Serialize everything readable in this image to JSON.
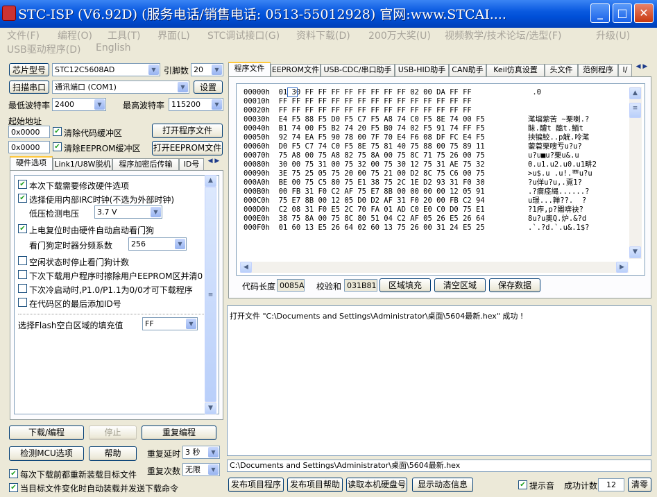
{
  "window": {
    "title": "STC-ISP (V6.92D) (服务电话/销售电话: 0513-55012928) 官网:www.STCAI...."
  },
  "menu": [
    "文件(F)",
    "编程(O)",
    "工具(T)",
    "界面(L)",
    "STC调试接口(G)",
    "资料下载(D)",
    "200万大奖(U)",
    "视频教学/技术论坛/选型(F)",
    "升级(U)",
    "USB驱动程序(D)",
    "English"
  ],
  "left": {
    "chip_btn": "芯片型号",
    "chip_value": "STC12C5608AD",
    "pin_label": "引脚数",
    "pin_value": "20",
    "scan_btn": "扫描串口",
    "port_value": "通讯端口 (COM1)",
    "settings_btn": "设置",
    "min_baud_label": "最低波特率",
    "min_baud": "2400",
    "max_baud_label": "最高波特率",
    "max_baud": "115200",
    "start_addr_label": "起始地址",
    "addr1": "0x0000",
    "clear_code": "清除代码缓冲区",
    "open_prog": "打开程序文件",
    "addr2": "0x0000",
    "clear_eeprom": "清除EEPROM缓冲区",
    "open_eeprom": "打开EEPROM文件",
    "tabs": [
      "硬件选项",
      "Link1/U8W脱机",
      "程序加密后传输",
      "ID号"
    ],
    "options": [
      {
        "label": "本次下载需要修改硬件选项",
        "checked": true
      },
      {
        "label": "选择使用内部IRC时钟(不选为外部时钟)",
        "checked": true
      },
      {
        "label": "低压检测电压",
        "value": "3.7 V"
      },
      {
        "label": "上电复位时由硬件自动启动看门狗",
        "checked": true
      },
      {
        "label": "看门狗定时器分频系数",
        "value": "256"
      },
      {
        "label": "空闲状态时停止看门狗计数",
        "checked": false
      },
      {
        "label": "下次下载用户程序时擦除用户EEPROM区并清0",
        "checked": false
      },
      {
        "label": "下次冷启动时,P1.0/P1.1为0/0才可下载程序",
        "checked": false
      },
      {
        "label": "在代码区的最后添加ID号",
        "checked": false
      }
    ],
    "fill_label": "选择Flash空白区域的填充值",
    "fill_value": "FF",
    "download_btn": "下载/编程",
    "stop_btn": "停止",
    "repeat_btn": "重复编程",
    "check_mcu_btn": "检测MCU选项",
    "help_btn": "帮助",
    "repeat_delay_label": "重复延时",
    "repeat_delay": "3 秒",
    "repeat_count_label": "重复次数",
    "repeat_count": "无限",
    "auto_reload": "每次下载前都重新装载目标文件",
    "auto_send": "当目标文件变化时自动装载并发送下载命令"
  },
  "right": {
    "tabs": [
      "程序文件",
      "EEPROM文件",
      "USB-CDC/串口助手",
      "USB-HID助手",
      "CAN助手",
      "Keil仿真设置",
      "头文件",
      "范例程序",
      "I/"
    ],
    "hex_rows": [
      {
        "addr": "00000h",
        "bytes": "01 30 FF FF FF FF FF FF FF FF 02 00 DA FF FF",
        "ascii": " .0"
      },
      {
        "addr": "00010h",
        "bytes": "FF FF FF FF FF FF FF FF FF FF FF FF FF FF FF",
        "ascii": ""
      },
      {
        "addr": "00020h",
        "bytes": "FF FF FF FF FF FF FF FF FF FF FF FF FF FF FF",
        "ascii": ""
      },
      {
        "addr": "00030h",
        "bytes": "E4 F5 88 F5 D0 F5 C7 F5 A8 74 C0 F5 8E 74 00 F5",
        "ascii": "滗堛萦苦 ~栗喇.?"
      },
      {
        "addr": "00040h",
        "bytes": "B1 74 00 F5 B2 74 20 F5 B0 74 02 F5 91 74 FF F5",
        "ascii": "眛.醴t 醢t.鮞t"
      },
      {
        "addr": "00050h",
        "bytes": "92 74 EA F5 90 78 00 7F 70 E4 F6 08 DF FC E4 F5",
        "ascii": "抰犏鮫..p觥.呤滗"
      },
      {
        "addr": "00060h",
        "bytes": "D0 F5 C7 74 C0 F5 8E 75 81 40 75 88 00 75 89 11",
        "ascii": "蓥菪栗嗖亐u?u?"
      },
      {
        "addr": "00070h",
        "bytes": "75 A8 00 75 A8 82 75 8A 00 75 8C 71 75 26 00 75",
        "ascii": "u?u■u?栗u&.u"
      },
      {
        "addr": "00080h",
        "bytes": "30 00 75 31 00 75 32 00 75 30 12 75 31 AE 75 32",
        "ascii": "0.u1.u2.u0.u1畊2"
      },
      {
        "addr": "00090h",
        "bytes": "3E 75 25 05 75 20 00 75 21 00 D2 8C 75 C6 00 75",
        "ascii": ">u$.u .u!.覀u?u"
      },
      {
        "addr": "000A0h",
        "bytes": "BE 00 75 C5 80 75 E1 38 75 2C 1E D2 93 31 F0 30",
        "ascii": "?u佯u?u,.覔1?"
      },
      {
        "addr": "000B0h",
        "bytes": "00 FB 31 F0 C2 AF 75 E7 8B 00 00 00 00 12 05 91",
        "ascii": ".?瘸痉縄......?"
      },
      {
        "addr": "000C0h",
        "bytes": "75 E7 8B 00 12 05 D0 D2 AF 31 F0 20 00 FB C2 94",
        "ascii": "u璟...亸??.  ?"
      },
      {
        "addr": "000D0h",
        "bytes": "C2 08 31 F0 E5 2C 70 FA 01 AD C0 E0 C0 D0 75 E1",
        "ascii": "?1痄,p?闂喯袂?"
      },
      {
        "addr": "000E0h",
        "bytes": "38 75 8A 00 75 8C 80 51 04 C2 AF 05 26 E5 26 64",
        "ascii": "8u?u奧Q.炉.&?d"
      },
      {
        "addr": "000F0h",
        "bytes": "01 60 13 E5 26 64 02 60 13 75 26 00 31 24 E5 25",
        "ascii": ".`.?d.`.u&.1$?"
      }
    ],
    "code_len_label": "代码长度",
    "code_len": "0085A",
    "checksum_label": "校验和",
    "checksum": "031B81",
    "fill_btn": "区域填充",
    "clear_btn": "清空区域",
    "save_btn": "保存数据",
    "log": "打开文件 \"C:\\Documents and Settings\\Administrator\\桌面\\5604最新.hex\" 成功 !",
    "path": "C:\\Documents and Settings\\Administrator\\桌面\\5604最新.hex",
    "pub_prog_btn": "发布项目程序",
    "pub_help_btn": "发布项目帮助",
    "read_disk_btn": "读取本机硬盘号",
    "show_dyn_btn": "显示动态信息",
    "beep_label": "提示音",
    "success_label": "成功计数",
    "success_count": "12",
    "clear_count_btn": "清零"
  }
}
